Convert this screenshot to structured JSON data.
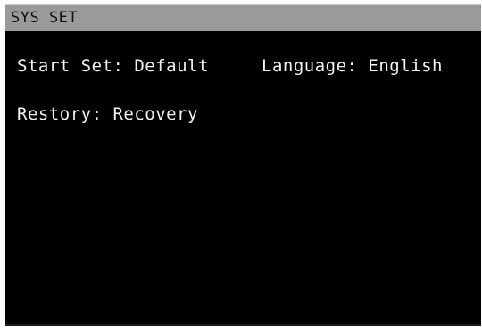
{
  "header": {
    "title": "SYS SET"
  },
  "settings": {
    "start_set": "Start Set: Default",
    "language": "Language: English",
    "restory": "Restory: Recovery"
  },
  "colors": {
    "screen_background": "#000000",
    "title_bar_background": "#9a9a9a",
    "text": "#f2f2f2"
  }
}
